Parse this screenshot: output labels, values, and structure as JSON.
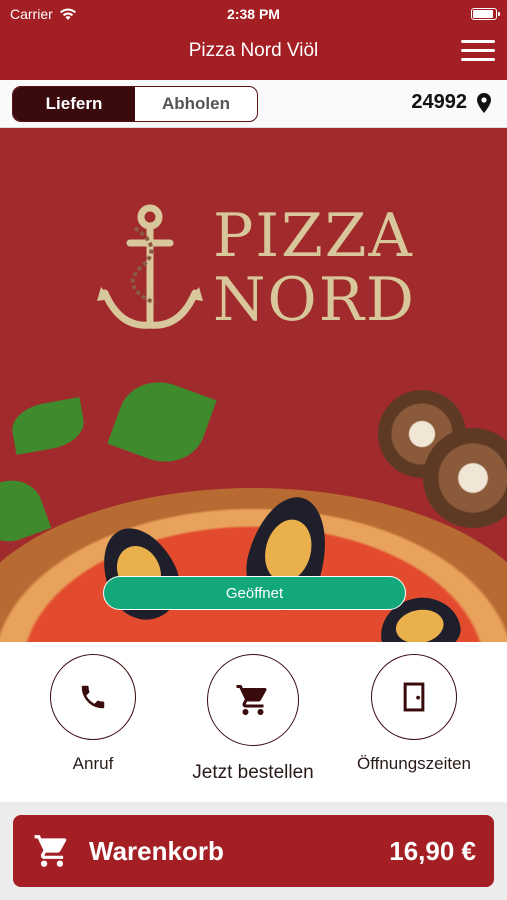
{
  "status": {
    "carrier": "Carrier",
    "time": "2:38 PM"
  },
  "header": {
    "title": "Pizza Nord Viöl"
  },
  "order_mode": {
    "delivery_label": "Liefern",
    "pickup_label": "Abholen",
    "selected": "Liefern",
    "postal_code": "24992"
  },
  "hero": {
    "logo_line1": "PIZZA",
    "logo_line2": "NORD",
    "status_label": "Geöffnet"
  },
  "actions": [
    {
      "label": "Anruf"
    },
    {
      "label": "Jetzt bestellen"
    },
    {
      "label": "Öffnungszeiten"
    }
  ],
  "cart": {
    "label": "Warenkorb",
    "total": "16,90 €"
  },
  "colors": {
    "brand_red": "#a31f24",
    "dark_maroon": "#3a0a0d",
    "open_green": "#12a879",
    "logo_gold": "#d8c79a"
  }
}
